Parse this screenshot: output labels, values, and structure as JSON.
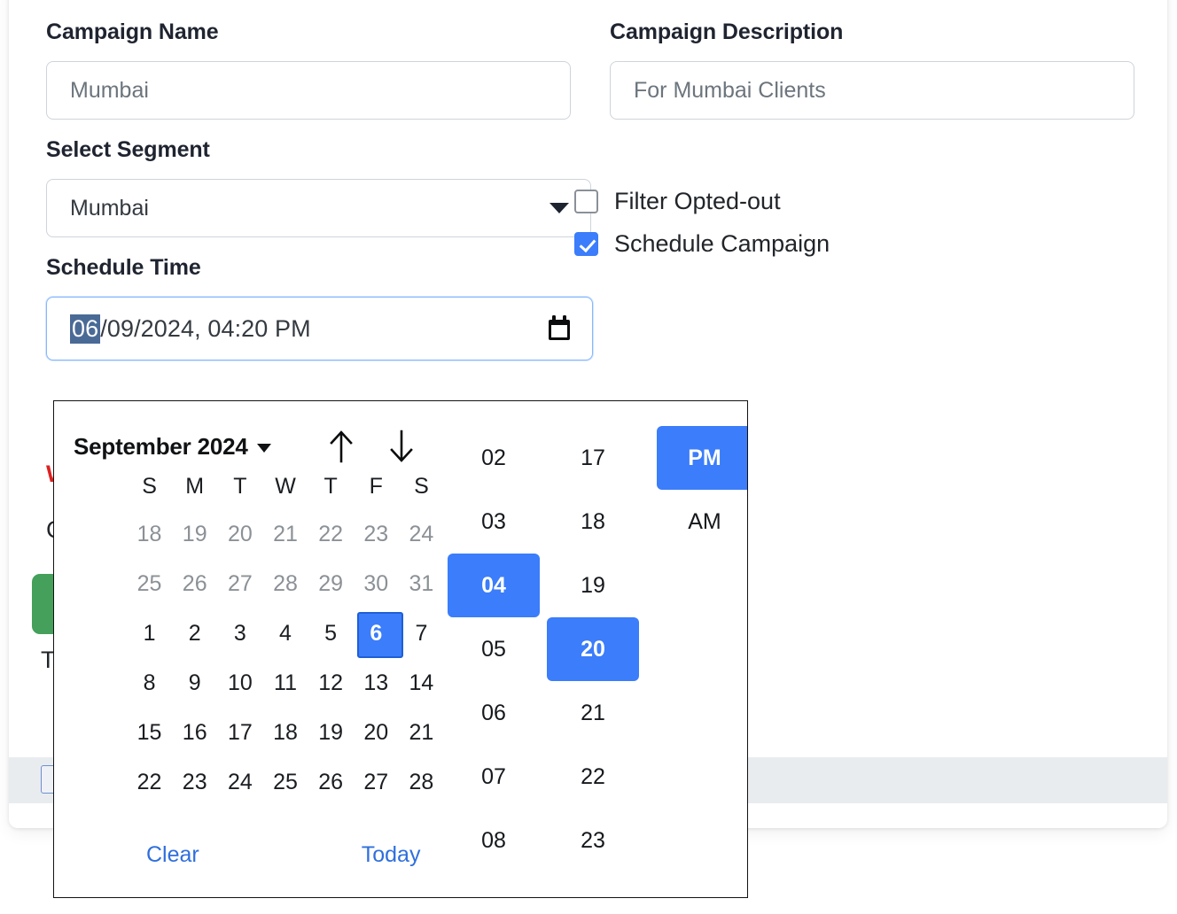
{
  "form": {
    "campaign_name": {
      "label": "Campaign Name",
      "value": "Mumbai"
    },
    "campaign_description": {
      "label": "Campaign Description",
      "value": "For Mumbai Clients"
    },
    "select_segment": {
      "label": "Select Segment",
      "value": "Mumbai",
      "caret": "chevron-down-icon"
    },
    "schedule_time": {
      "label": "Schedule Time",
      "selected_segment_text": "06",
      "rest_text": "/09/2024, 04:20 PM",
      "icon": "calendar-icon"
    },
    "checkboxes": [
      {
        "label": "Filter Opted-out",
        "checked": false
      },
      {
        "label": "Schedule Campaign",
        "checked": true
      }
    ]
  },
  "background": {
    "warning_text": "W",
    "line_text": "C",
    "green_button_label": "",
    "line2_text": "T"
  },
  "picker": {
    "month_label": "September 2024",
    "month_caret": "triangle-down-icon",
    "nav_up": "arrow-up-icon",
    "nav_down": "arrow-down-icon",
    "day_headers": [
      "S",
      "M",
      "T",
      "W",
      "T",
      "F",
      "S"
    ],
    "weeks": [
      [
        {
          "d": "18",
          "muted": true
        },
        {
          "d": "19",
          "muted": true
        },
        {
          "d": "20",
          "muted": true
        },
        {
          "d": "21",
          "muted": true
        },
        {
          "d": "22",
          "muted": true
        },
        {
          "d": "23",
          "muted": true
        },
        {
          "d": "24",
          "muted": true
        }
      ],
      [
        {
          "d": "25",
          "muted": true
        },
        {
          "d": "26",
          "muted": true
        },
        {
          "d": "27",
          "muted": true
        },
        {
          "d": "28",
          "muted": true
        },
        {
          "d": "29",
          "muted": true
        },
        {
          "d": "30",
          "muted": true
        },
        {
          "d": "31",
          "muted": true
        }
      ],
      [
        {
          "d": "1"
        },
        {
          "d": "2"
        },
        {
          "d": "3"
        },
        {
          "d": "4"
        },
        {
          "d": "5"
        },
        {
          "d": "6",
          "selected": true
        },
        {
          "d": "7"
        }
      ],
      [
        {
          "d": "8"
        },
        {
          "d": "9"
        },
        {
          "d": "10"
        },
        {
          "d": "11"
        },
        {
          "d": "12"
        },
        {
          "d": "13"
        },
        {
          "d": "14"
        }
      ],
      [
        {
          "d": "15"
        },
        {
          "d": "16"
        },
        {
          "d": "17"
        },
        {
          "d": "18"
        },
        {
          "d": "19"
        },
        {
          "d": "20"
        },
        {
          "d": "21"
        }
      ],
      [
        {
          "d": "22"
        },
        {
          "d": "23"
        },
        {
          "d": "24"
        },
        {
          "d": "25"
        },
        {
          "d": "26"
        },
        {
          "d": "27"
        },
        {
          "d": "28"
        }
      ]
    ],
    "clear_label": "Clear",
    "today_label": "Today",
    "hours": [
      {
        "v": "02"
      },
      {
        "v": "03"
      },
      {
        "v": "04",
        "selected": true
      },
      {
        "v": "05"
      },
      {
        "v": "06"
      },
      {
        "v": "07"
      },
      {
        "v": "08"
      }
    ],
    "minutes": [
      {
        "v": "17"
      },
      {
        "v": "18"
      },
      {
        "v": "19"
      },
      {
        "v": "20",
        "selected": true
      },
      {
        "v": "21"
      },
      {
        "v": "22"
      },
      {
        "v": "23"
      }
    ],
    "meridiem": [
      {
        "v": "PM",
        "selected": true
      },
      {
        "v": "AM"
      }
    ]
  },
  "colors": {
    "accent_blue": "#3b7dfa",
    "selected_border": "#1f5fd6",
    "link_blue": "#2f6fdd",
    "segment_highlight": "#4a6a96",
    "warning_red": "#e02020",
    "green_button": "#44a05a"
  }
}
